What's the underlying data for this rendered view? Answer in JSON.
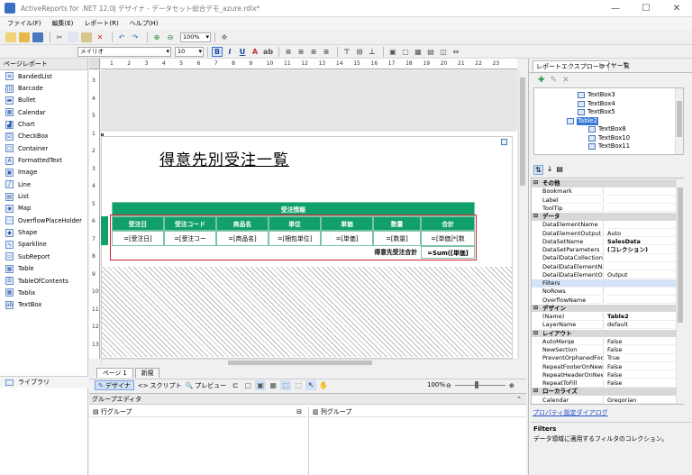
{
  "window": {
    "title": "ActiveReports for .NET 12.0J デザイナ - データセット総合デモ_azure.rdlx*",
    "controls": [
      "—",
      "☐",
      "✕"
    ]
  },
  "menu": [
    "ファイル(F)",
    "編集(E)",
    "レポート(R)",
    "ヘルプ(H)"
  ],
  "toolbar": {
    "zoom": "100%",
    "font_name": "メイリオ",
    "font_size": "10"
  },
  "toolbox": {
    "header": "ページレポート",
    "items": [
      "BandedList",
      "Barcode",
      "Bullet",
      "Calendar",
      "Chart",
      "CheckBox",
      "Container",
      "FormattedText",
      "Image",
      "Line",
      "List",
      "Map",
      "OverflowPlaceHolder",
      "Shape",
      "Sparkline",
      "SubReport",
      "Table",
      "TableOfContents",
      "Tablix",
      "TextBox"
    ],
    "library_tab": "ライブラリ"
  },
  "ruler": {
    "h_labels": [
      "1",
      "2",
      "3",
      "4",
      "5",
      "6",
      "7",
      "8",
      "9",
      "10",
      "11",
      "12",
      "13",
      "14",
      "15",
      "16",
      "17",
      "18",
      "19",
      "20",
      "21",
      "22",
      "23"
    ],
    "v_labels": [
      "3",
      "4",
      "5",
      "1",
      "2",
      "3",
      "4",
      "5",
      "6",
      "7",
      "8",
      "9",
      "10",
      "11",
      "12",
      "13"
    ]
  },
  "report": {
    "title": "得意先別受注一覧",
    "table": {
      "group_header": "受注情報",
      "columns": [
        "受注日",
        "受注コード",
        "商品名",
        "単位",
        "単価",
        "数量",
        "合計"
      ],
      "data_row": [
        "=[受注日]",
        "=[受注コー",
        "=[商品名]",
        "=[梱包単位]",
        "=[単価]",
        "=[数量]",
        "=[単価]*[数"
      ],
      "total_label": "得意先受注合計",
      "total_value": "=Sum([単価]"
    }
  },
  "pagetabs": [
    "ページ 1",
    "新規"
  ],
  "designtoolbar": {
    "design": "デザイナ",
    "script": "スクリプト",
    "preview": "プレビュー",
    "zoom": "100%"
  },
  "groupeditor": {
    "title": "グループエディタ",
    "row_group": "行グループ",
    "col_group": "列グループ"
  },
  "rightpanel": {
    "tab_explorer": "レポートエクスプローラ",
    "tab_layer": "レイヤー覧",
    "tree": [
      {
        "label": "TextBox3",
        "indent": 3
      },
      {
        "label": "TextBox4",
        "indent": 3
      },
      {
        "label": "TextBox5",
        "indent": 3
      },
      {
        "label": "Table2",
        "indent": 2,
        "selected": true
      },
      {
        "label": "TextBox8",
        "indent": 4
      },
      {
        "label": "TextBox10",
        "indent": 4
      },
      {
        "label": "TextBox11",
        "indent": 4
      }
    ],
    "properties": [
      {
        "cat": "その他"
      },
      {
        "name": "Bookmark",
        "value": ""
      },
      {
        "name": "Label",
        "value": ""
      },
      {
        "name": "ToolTip",
        "value": ""
      },
      {
        "cat": "データ"
      },
      {
        "name": "DataElementName",
        "value": ""
      },
      {
        "name": "DataElementOutput",
        "value": "Auto"
      },
      {
        "name": "DataSetName",
        "value": "SalesData",
        "bold": true
      },
      {
        "name": "DataSetParameters",
        "value": "(コレクション)",
        "bold": true
      },
      {
        "name": "DetailDataCollection",
        "value": ""
      },
      {
        "name": "DetailDataElementNa",
        "value": ""
      },
      {
        "name": "DetailDataElementOu",
        "value": "Output"
      },
      {
        "name": "Filters",
        "value": "",
        "highlight": true
      },
      {
        "name": "NoRows",
        "value": ""
      },
      {
        "name": "OverflowName",
        "value": ""
      },
      {
        "cat": "デザイン"
      },
      {
        "name": "(Name)",
        "value": "Table2",
        "bold": true
      },
      {
        "name": "LayerName",
        "value": "default"
      },
      {
        "cat": "レイアウト"
      },
      {
        "name": "AutoMerge",
        "value": "False"
      },
      {
        "name": "NewSection",
        "value": "False"
      },
      {
        "name": "PreventOrphanedFoo",
        "value": "True"
      },
      {
        "name": "RepeatFooterOnNew",
        "value": "False"
      },
      {
        "name": "RepeatHeaderOnNew",
        "value": "False"
      },
      {
        "name": "RepeatToFill",
        "value": "False"
      },
      {
        "cat": "ローカライズ"
      },
      {
        "name": "Calendar",
        "value": "Gregorian"
      }
    ],
    "dialog_link": "プロパティ設定ダイアログ",
    "desc_title": "Filters",
    "desc_text": "データ領域に適用するフィルタのコレクション。"
  }
}
